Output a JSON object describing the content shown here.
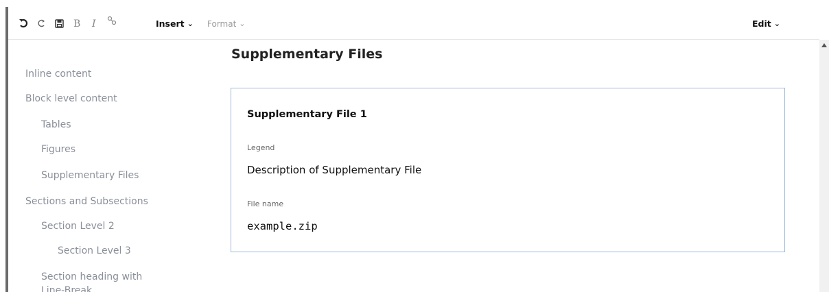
{
  "toolbar": {
    "icons": [
      "undo-icon",
      "redo-icon",
      "save-icon",
      "bold-icon",
      "italic-icon",
      "link-icon"
    ],
    "insert_label": "Insert",
    "format_label": "Format",
    "edit_label": "Edit",
    "chevron": "⌄"
  },
  "toc": {
    "items": [
      {
        "label": "Inline content",
        "level": 1
      },
      {
        "label": "Block level content",
        "level": 1
      },
      {
        "label": "Tables",
        "level": 2
      },
      {
        "label": "Figures",
        "level": 2
      },
      {
        "label": "Supplementary Files",
        "level": 2
      },
      {
        "label": "Sections and Subsections",
        "level": 1
      },
      {
        "label": "Section Level 2",
        "level": 2
      },
      {
        "label": "Section Level 3",
        "level": 3
      },
      {
        "label": "Section heading with",
        "level": 2
      },
      {
        "label": "Line-Break",
        "level": 2
      }
    ]
  },
  "main": {
    "section_title": "Supplementary Files",
    "card": {
      "title": "Supplementary File 1",
      "legend_label": "Legend",
      "legend_value": "Description of Supplementary File",
      "file_name_label": "File name",
      "file_name_value": "example.zip"
    }
  },
  "colors": {
    "card_border": "#9cb9de",
    "toc_text": "#8a8f99",
    "disabled_text": "#9b9b9b"
  }
}
